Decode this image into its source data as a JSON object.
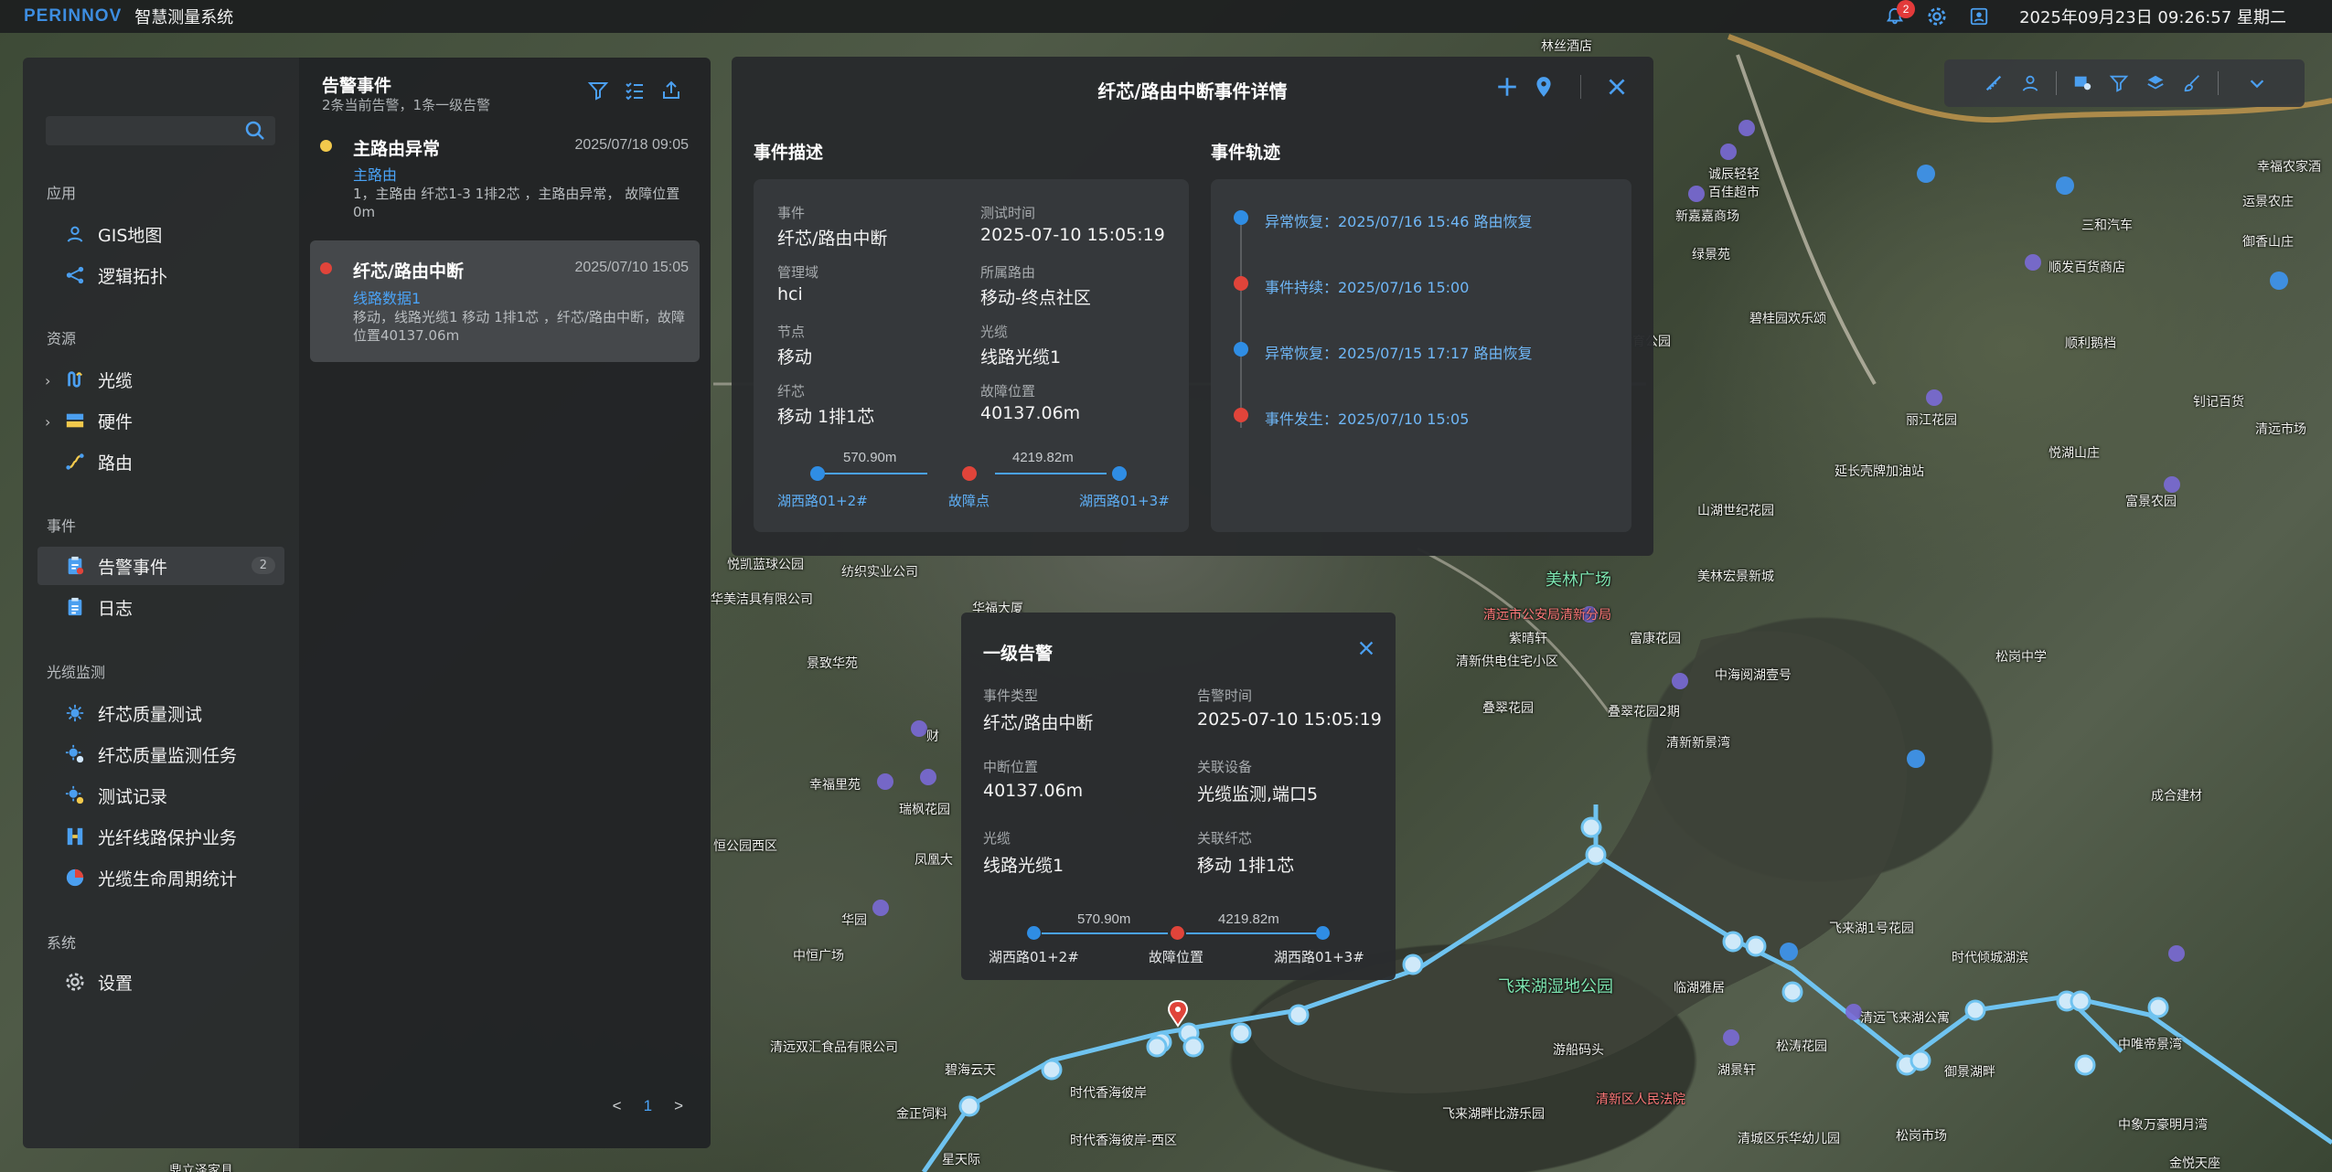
{
  "topbar": {
    "logo": "PERINNOV",
    "system_name": "智慧测量系统",
    "alarm_count": "2",
    "datetime": "2025年09月23日 09:26:57 星期二"
  },
  "sidebar": {
    "search_placeholder": "",
    "sections": {
      "app": "应用",
      "resource": "资源",
      "event": "事件",
      "cable_monitor": "光缆监测",
      "system": "系统"
    },
    "items": {
      "gis": "GIS地图",
      "topology": "逻辑拓扑",
      "cable": "光缆",
      "hardware": "硬件",
      "route": "路由",
      "alarm": "告警事件",
      "alarm_count": "2",
      "log": "日志",
      "fiber_test": "纤芯质量测试",
      "fiber_task": "纤芯质量监测任务",
      "test_record": "测试记录",
      "protection": "光纤线路保护业务",
      "lifecycle": "光缆生命周期统计",
      "settings": "设置"
    }
  },
  "alarm_panel": {
    "title": "告警事件",
    "subtitle": "2条当前告警，1条一级告警",
    "items": [
      {
        "name": "主路由异常",
        "time": "2025/07/18 09:05",
        "route": "主路由",
        "desc": "1，主路由 纤芯1-3 1排2芯 ，主路由异常， 故障位置0m",
        "dot_color": "#f2c94c"
      },
      {
        "name": "纤芯/路由中断",
        "time": "2025/07/10 15:05",
        "route": "线路数据1",
        "desc": "移动，线路光缆1 移动 1排1芯 ，纤芯/路由中断，故障位置40137.06m",
        "dot_color": "#e0443a"
      }
    ],
    "pager": {
      "prev": "<",
      "current": "1",
      "next": ">"
    }
  },
  "detail": {
    "title": "纤芯/路由中断事件详情",
    "desc_heading": "事件描述",
    "track_heading": "事件轨迹",
    "fields": {
      "event_k": "事件",
      "event_v": "纤芯/路由中断",
      "test_time_k": "测试时间",
      "test_time_v": "2025-07-10 15:05:19",
      "domain_k": "管理域",
      "domain_v": "hci",
      "route_k": "所属路由",
      "route_v": "移动-终点社区",
      "node_k": "节点",
      "node_v": "移动",
      "cable_k": "光缆",
      "cable_v": "线路光缆1",
      "core_k": "纤芯",
      "core_v": "移动 1排1芯",
      "fault_k": "故障位置",
      "fault_v": "40137.06m"
    },
    "topo": {
      "left_dist": "570.90m",
      "right_dist": "4219.82m",
      "left_label": "湖西路01+2#",
      "mid_label": "故障点",
      "right_label": "湖西路01+3#"
    },
    "track": [
      {
        "text": "异常恢复：2025/07/16 15:46  路由恢复",
        "color": "#2f8de4"
      },
      {
        "text": "事件持续：2025/07/16 15:00",
        "color": "#e0443a"
      },
      {
        "text": "异常恢复：2025/07/15 17:17  路由恢复",
        "color": "#2f8de4"
      },
      {
        "text": "事件发生：2025/07/10 15:05",
        "color": "#e0443a"
      }
    ]
  },
  "popup": {
    "title": "一级告警",
    "fields": {
      "type_k": "事件类型",
      "type_v": "纤芯/路由中断",
      "time_k": "告警时间",
      "time_v": "2025-07-10 15:05:19",
      "pos_k": "中断位置",
      "pos_v": "40137.06m",
      "dev_k": "关联设备",
      "dev_v": "光缆监测,端口5",
      "cable_k": "光缆",
      "cable_v": "线路光缆1",
      "core_k": "关联纤芯",
      "core_v": "移动 1排1芯"
    },
    "topo": {
      "left_dist": "570.90m",
      "right_dist": "4219.82m",
      "left_label": "湖西路01+2#",
      "mid_label": "故障位置",
      "right_label": "湖西路01+3#"
    }
  },
  "map_labels": [
    "林丝酒店",
    "诚辰轻轻",
    "百佳超市",
    "新嘉嘉商场",
    "绿景苑",
    "碧桂园欢乐颂",
    "林体育公园",
    "幸福农家酒",
    "运景农庄",
    "御香山庄",
    "三和汽车",
    "顺发百货商店",
    "顺利鹅档",
    "丽江花园",
    "钊记百货",
    "清远市场",
    "悦湖山庄",
    "延长壳牌加油站",
    "富景农园",
    "山湖世纪花园",
    "美林宏景新城",
    "美林广场",
    "清远市公安局清新分局",
    "紫晴轩",
    "富康花园",
    "中海阅湖壹号",
    "清新供电住宅小区",
    "叠翠花园",
    "叠翠花园2期",
    "清新新景湾",
    "松岗中学",
    "成合建材",
    "飞来湖湿地公园",
    "飞来湖1号花园",
    "时代倾城湖滨",
    "临湖雅居",
    "游船码头",
    "清远飞来湖公寓",
    "松涛花园",
    "湖景轩",
    "御景湖畔",
    "中唯帝景湾",
    "清新区人民法院",
    "飞来湖畔比游乐园",
    "清城区乐华幼儿园",
    "松岗市场",
    "中象万豪明月湾",
    "金悦天座",
    "悦凯蓝球公园",
    "纺织实业公司",
    "华美洁具有限公司",
    "华福大厦",
    "景致华苑",
    "财",
    "幸福里苑",
    "瑞枫花园",
    "恒公园西区",
    "凤凰大",
    "华园",
    "中恒广场",
    "清远双汇食品有限公司",
    "碧海云天",
    "时代香海彼岸",
    "金正饲料",
    "时代香海彼岸-西区",
    "星天际",
    "鼎立泽家具"
  ],
  "map_colors": {
    "route_line": "#6fc3f0",
    "fault_marker": "#e0443a",
    "accent": "#2f8de4"
  }
}
